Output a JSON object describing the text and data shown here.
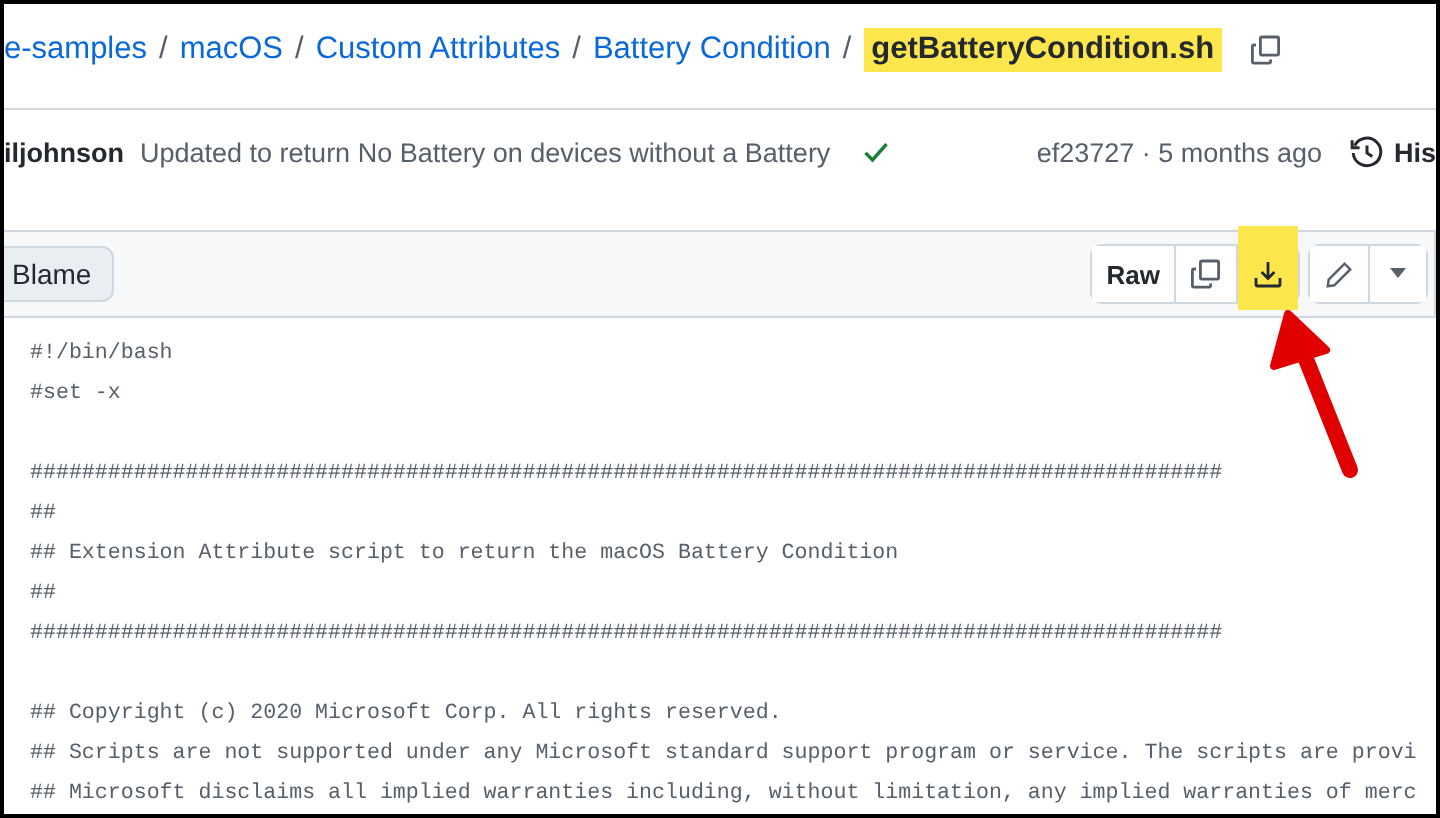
{
  "breadcrumb": {
    "links": [
      {
        "label": "e-samples",
        "separator": "/"
      },
      {
        "label": "macOS",
        "separator": "/"
      },
      {
        "label": "Custom Attributes",
        "separator": "/"
      },
      {
        "label": "Battery Condition",
        "separator": "/"
      }
    ],
    "current": {
      "label": "getBatteryCondition.sh",
      "highlighted": true
    }
  },
  "commit": {
    "author": "iljohnson",
    "message": "Updated to return No Battery on devices without a Battery",
    "checks_passed": true,
    "meta": "ef23727 · 5 months ago",
    "history": "His"
  },
  "file_header": {
    "view_buttons": [
      {
        "label": "Blame",
        "selected": false
      }
    ],
    "actions": [
      {
        "kind": "raw",
        "label": "Raw",
        "highlighted": false
      },
      {
        "kind": "copy",
        "highlighted": false
      },
      {
        "kind": "download",
        "highlighted": true
      },
      {
        "kind": "edit",
        "highlighted": false
      },
      {
        "kind": "more",
        "highlighted": false
      }
    ]
  },
  "code": {
    "lines": [
      {
        "kind": "code",
        "text": "#!/bin/bash"
      },
      {
        "kind": "code",
        "text": "#set -x"
      },
      {
        "kind": "blank"
      },
      {
        "kind": "code",
        "text": "############################################################################################"
      },
      {
        "kind": "code",
        "text": "##"
      },
      {
        "kind": "code",
        "text": "## Extension Attribute script to return the macOS Battery Condition"
      },
      {
        "kind": "code",
        "text": "##"
      },
      {
        "kind": "code",
        "text": "############################################################################################"
      },
      {
        "kind": "blank"
      },
      {
        "kind": "code",
        "text": "## Copyright (c) 2020 Microsoft Corp. All rights reserved."
      },
      {
        "kind": "code",
        "text": "## Scripts are not supported under any Microsoft standard support program or service. The scripts are provi"
      },
      {
        "kind": "code",
        "text": "## Microsoft disclaims all implied warranties including, without limitation, any implied warranties of merc"
      }
    ]
  },
  "annotations": [
    {
      "kind": "arrow"
    }
  ]
}
